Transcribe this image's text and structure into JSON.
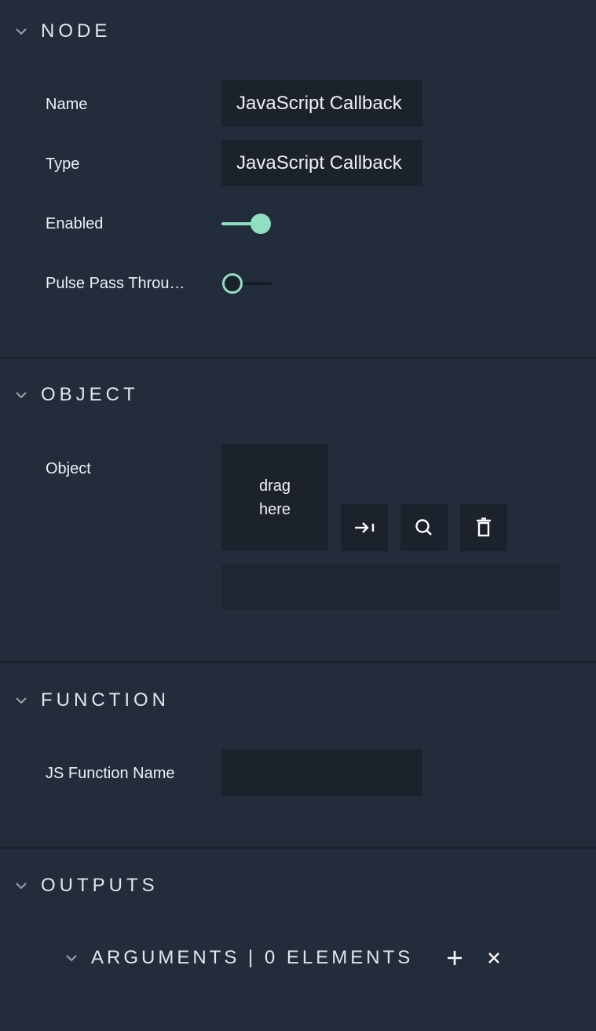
{
  "sections": {
    "node": {
      "title": "NODE",
      "fields": {
        "name_label": "Name",
        "name_value": "JavaScript Callback",
        "type_label": "Type",
        "type_value": "JavaScript Callback",
        "enabled_label": "Enabled",
        "enabled_state": true,
        "pulse_label": "Pulse Pass Throu…",
        "pulse_state": false
      }
    },
    "object": {
      "title": "OBJECT",
      "object_label": "Object",
      "dropzone_text_line1": "drag",
      "dropzone_text_line2": "here",
      "object_value": ""
    },
    "function": {
      "title": "FUNCTION",
      "js_function_label": "JS Function Name",
      "js_function_value": ""
    },
    "outputs": {
      "title": "OUTPUTS",
      "arguments_title": "ARGUMENTS | 0 ELEMENTS"
    }
  },
  "icons": {
    "collapse": "chevron-down-icon",
    "assign": "arrow-to-bar-icon",
    "search": "search-icon",
    "delete": "trash-icon",
    "add": "plus-icon",
    "clear": "close-icon"
  },
  "colors": {
    "background": "#222c3a",
    "field": "#1b222c",
    "accent": "#8fe0c2"
  }
}
